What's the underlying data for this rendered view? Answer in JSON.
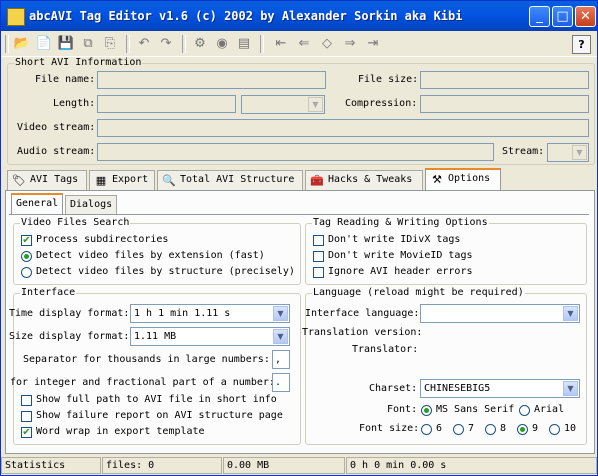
{
  "window": {
    "title": "abcAVI Tag Editor v1.6 (c) 2002 by Alexander Sorkin aka Kibi"
  },
  "titlebar_buttons": [
    "_",
    "□",
    "✕"
  ],
  "toolbar": {
    "help_label": "?"
  },
  "short_info": {
    "legend": "Short AVI Information",
    "file_name_label": "File name:",
    "file_size_label": "File size:",
    "length_label": "Length:",
    "compression_label": "Compression:",
    "video_stream_label": "Video stream:",
    "audio_stream_label": "Audio stream:",
    "stream_label": "Stream:"
  },
  "main_tabs": [
    {
      "label": "AVI Tags",
      "icon": "tag-icon"
    },
    {
      "label": "Export",
      "icon": "table-icon"
    },
    {
      "label": "Total AVI Structure",
      "icon": "magnifier-icon"
    },
    {
      "label": "Hacks & Tweaks",
      "icon": "tools-icon"
    },
    {
      "label": "Options",
      "icon": "options-icon"
    }
  ],
  "sub_tabs": [
    "General",
    "Dialogs"
  ],
  "video_search": {
    "legend": "Video Files Search",
    "process_subdirs": "Process subdirectories",
    "detect_ext": "Detect video files by extension (fast)",
    "detect_struct": "Detect video files by structure (precisely)"
  },
  "tag_options": {
    "legend": "Tag Reading & Writing Options",
    "no_idivx": "Don't write IDivX tags",
    "no_movieid": "Don't write MovieID tags",
    "ignore_header": "Ignore AVI header errors"
  },
  "interface": {
    "legend": "Interface",
    "time_format_label": "Time display format:",
    "time_format_value": "1 h 1 min 1.11 s",
    "size_format_label": "Size display format:",
    "size_format_value": "1.11 MB",
    "separator_label": "Separator for thousands in large numbers:",
    "separator_value": ",",
    "decimal_label": "for integer and fractional part of a number:",
    "decimal_value": ".",
    "show_full_path": "Show full path to AVI file in short info",
    "show_failure": "Show failure report on AVI structure page",
    "word_wrap": "Word wrap in export template"
  },
  "language": {
    "legend": "Language (reload might be required)",
    "interface_language_label": "Interface language:",
    "translation_version_label": "Translation version:",
    "translator_label": "Translator:",
    "charset_label": "Charset:",
    "charset_value": "CHINESEBIG5",
    "font_label": "Font:",
    "font_options": [
      "MS Sans Serif",
      "Arial"
    ],
    "font_size_label": "Font size:",
    "font_sizes": [
      "6",
      "7",
      "8",
      "9",
      "10"
    ]
  },
  "statusbar": {
    "label": "Statistics",
    "files": "files: 0",
    "size": "0.00 MB",
    "time": "0 h 0 min 0.00 s"
  }
}
